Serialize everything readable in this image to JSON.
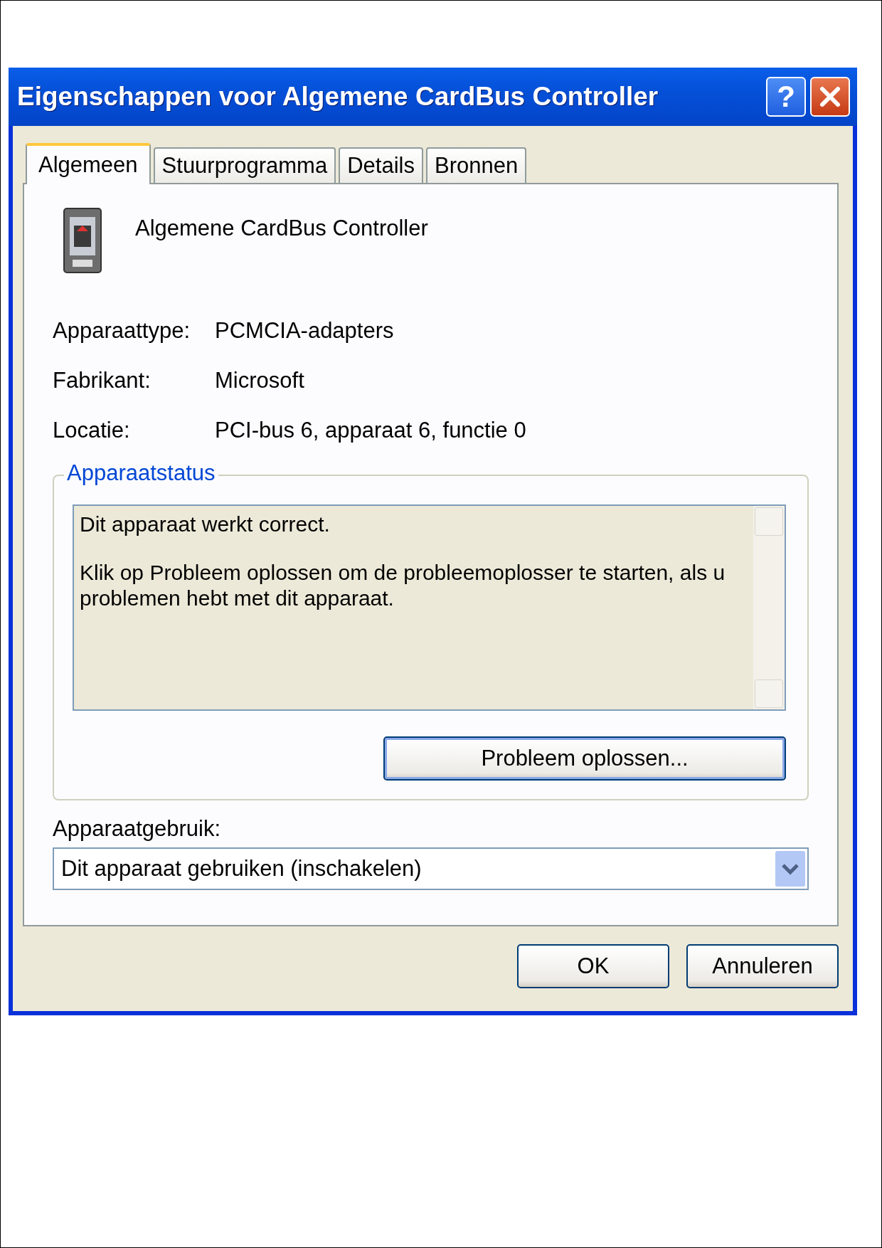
{
  "window": {
    "title": "Eigenschappen voor Algemene CardBus Controller",
    "help_button": "?"
  },
  "tabs": [
    {
      "label": "Algemeen",
      "selected": true
    },
    {
      "label": "Stuurprogramma",
      "selected": false
    },
    {
      "label": "Details",
      "selected": false
    },
    {
      "label": "Bronnen",
      "selected": false
    }
  ],
  "device_name": "Algemene CardBus Controller",
  "properties": [
    {
      "label": "Apparaattype:",
      "value": "PCMCIA-adapters"
    },
    {
      "label": "Fabrikant:",
      "value": "Microsoft"
    },
    {
      "label": "Locatie:",
      "value": "PCI-bus 6, apparaat 6, functie 0"
    }
  ],
  "device_status": {
    "title": "Apparaatstatus",
    "paragraphs": [
      "Dit apparaat werkt correct.",
      "Klik op Probleem oplossen om de probleemoplosser te starten, als u problemen hebt met dit apparaat."
    ],
    "button": "Probleem oplossen..."
  },
  "device_usage": {
    "label": "Apparaatgebruik:",
    "value": "Dit apparaat gebruiken (inschakelen)"
  },
  "buttons": [
    "OK",
    "Annuleren"
  ]
}
